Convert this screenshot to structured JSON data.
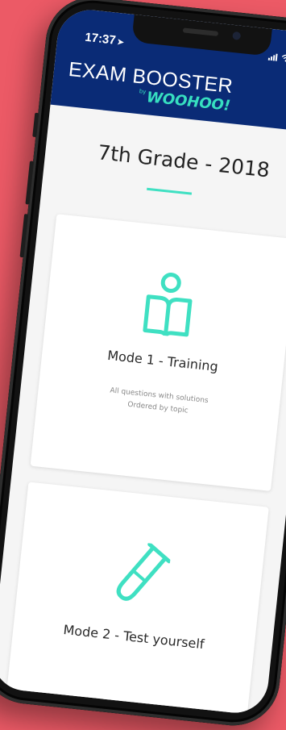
{
  "status_bar": {
    "time": "17:37",
    "location_icon": "location-arrow-icon",
    "icons": [
      "cell-signal-icon",
      "wifi-icon",
      "battery-icon"
    ],
    "battery_level": 0.9
  },
  "header": {
    "logo_main": "EXAM BOOSTER",
    "logo_by": "by",
    "logo_sub": "WOOHOO!",
    "menu_icon": "hamburger-menu-icon",
    "background_color": "#0a2b76",
    "accent_color": "#37dfc0"
  },
  "page": {
    "title": "7th Grade - 2018"
  },
  "modes": [
    {
      "icon": "reading-person-icon",
      "title": "Mode 1 - Training",
      "desc_line1": "All questions with solutions",
      "desc_line2": "Ordered by topic"
    },
    {
      "icon": "test-tube-icon",
      "title": "Mode 2 - Test yourself"
    }
  ],
  "colors": {
    "background": "#ec5a66",
    "accent": "#3fe0c2"
  }
}
